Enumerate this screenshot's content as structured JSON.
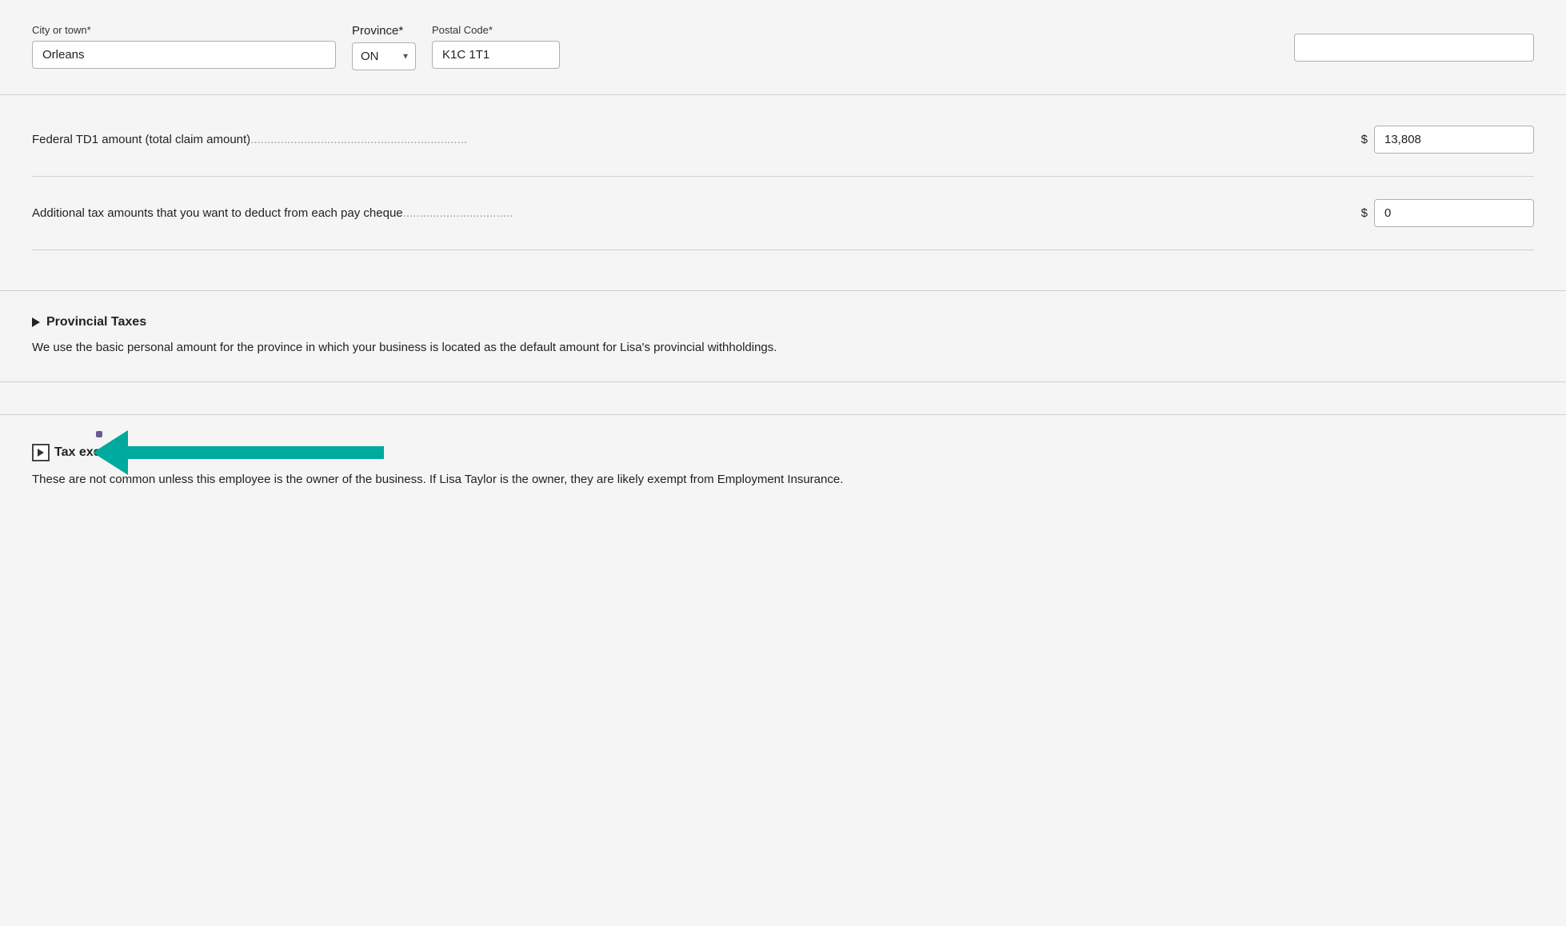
{
  "address": {
    "city_label": "City or town*",
    "city_value": "Orleans",
    "province_label": "Province*",
    "province_value": "ON",
    "postal_label": "Postal Code*",
    "postal_value": "K1C 1T1",
    "right_input_value": ""
  },
  "tax_fields": {
    "federal_td1": {
      "label_text": "Federal TD1 amount (total claim amount)",
      "dots": ".................................................................",
      "dollar": "$",
      "value": "13,808"
    },
    "additional_tax": {
      "label_text": "Additional tax amounts that you want to deduct from each pay cheque",
      "dots": ".................................",
      "dollar": "$",
      "value": "0"
    }
  },
  "provincial_taxes": {
    "title": "Provincial Taxes",
    "description": "We use the basic personal amount for the province in which your business is located as the default amount for Lisa's provincial withholdings."
  },
  "tax_exemptions": {
    "title": "Tax exemptions",
    "description": "These are not common unless this employee is the owner of the business. If Lisa Taylor is the owner, they are likely exempt from Employment Insurance."
  },
  "colors": {
    "arrow": "#00a99d",
    "dot": "#6b5b95"
  }
}
